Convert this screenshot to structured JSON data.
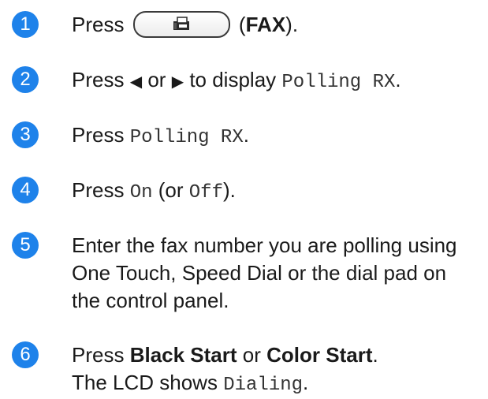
{
  "steps": [
    {
      "number": "1",
      "press": "Press",
      "fax_key": "(FAX)",
      "fax_key_label": "FAX",
      "icon": "fax-icon"
    },
    {
      "number": "2",
      "press": "Press",
      "left_arrow": "◀",
      "or": "or",
      "right_arrow": "▶",
      "to_display": "to display",
      "menu": "Polling RX",
      "period": "."
    },
    {
      "number": "3",
      "press": "Press",
      "menu": "Polling RX",
      "period": "."
    },
    {
      "number": "4",
      "press": "Press",
      "on": "On",
      "or_open": "(or",
      "off": "Off",
      "close": ")."
    },
    {
      "number": "5",
      "text": "Enter the fax number you are polling using One Touch, Speed Dial or the dial pad on the control panel."
    },
    {
      "number": "6",
      "press": "Press",
      "black_start": "Black Start",
      "or": "or",
      "color_start": "Color Start",
      "period": ".",
      "line2_prefix": "The LCD shows",
      "lcd": "Dialing",
      "line2_suffix": "."
    }
  ]
}
